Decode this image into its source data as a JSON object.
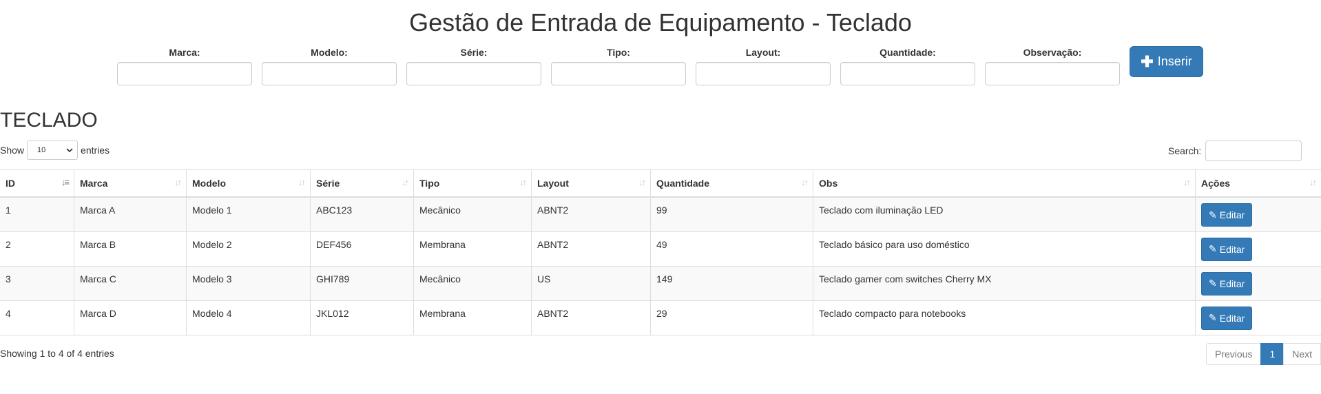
{
  "header": {
    "title": "Gestão de Entrada de Equipamento - Teclado"
  },
  "form": {
    "fields": [
      {
        "label": "Marca:",
        "value": ""
      },
      {
        "label": "Modelo:",
        "value": ""
      },
      {
        "label": "Série:",
        "value": ""
      },
      {
        "label": "Tipo:",
        "value": ""
      },
      {
        "label": "Layout:",
        "value": ""
      },
      {
        "label": "Quantidade:",
        "value": ""
      },
      {
        "label": "Observação:",
        "value": ""
      }
    ],
    "insert_label": "Inserir",
    "insert_icon": "plus-icon"
  },
  "section": {
    "title": "TECLADO"
  },
  "length": {
    "show_label": "Show",
    "value": "10",
    "entries_label": "entries"
  },
  "search": {
    "label": "Search:",
    "value": ""
  },
  "table": {
    "columns": [
      "ID",
      "Marca",
      "Modelo",
      "Série",
      "Tipo",
      "Layout",
      "Quantidade",
      "Obs",
      "Ações"
    ],
    "sorted_column": "ID",
    "rows": [
      {
        "id": "1",
        "marca": "Marca A",
        "modelo": "Modelo 1",
        "serie": "ABC123",
        "tipo": "Mecânico",
        "layout": "ABNT2",
        "quantidade": "99",
        "obs": "Teclado com iluminação LED",
        "action": "Editar"
      },
      {
        "id": "2",
        "marca": "Marca B",
        "modelo": "Modelo 2",
        "serie": "DEF456",
        "tipo": "Membrana",
        "layout": "ABNT2",
        "quantidade": "49",
        "obs": "Teclado básico para uso doméstico",
        "action": "Editar"
      },
      {
        "id": "3",
        "marca": "Marca C",
        "modelo": "Modelo 3",
        "serie": "GHI789",
        "tipo": "Mecânico",
        "layout": "US",
        "quantidade": "149",
        "obs": "Teclado gamer com switches Cherry MX",
        "action": "Editar"
      },
      {
        "id": "4",
        "marca": "Marca D",
        "modelo": "Modelo 4",
        "serie": "JKL012",
        "tipo": "Membrana",
        "layout": "ABNT2",
        "quantidade": "29",
        "obs": "Teclado compacto para notebooks",
        "action": "Editar"
      }
    ]
  },
  "footer": {
    "info": "Showing 1 to 4 of 4 entries",
    "pagination": {
      "previous": "Previous",
      "current": "1",
      "next": "Next"
    }
  },
  "colors": {
    "primary": "#337ab7",
    "border": "#dddddd",
    "stripe": "#f9f9f9"
  }
}
